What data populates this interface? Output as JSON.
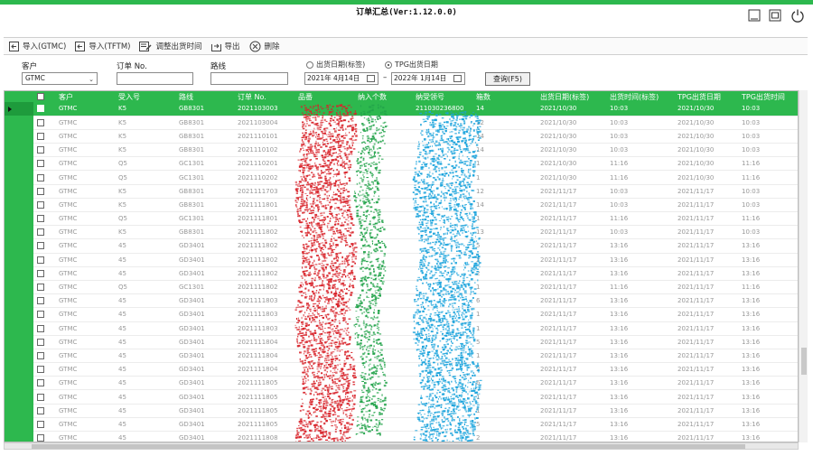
{
  "window": {
    "title": "订单汇总(Ver:1.12.0.0)"
  },
  "colors": {
    "accent": "#2db84e",
    "smear_red": "#d8232a",
    "smear_green": "#22a34a",
    "smear_blue": "#1aa3dc"
  },
  "toolbar": {
    "items": [
      {
        "label": "导入(GTMC)",
        "icon": "import-icon"
      },
      {
        "label": "导入(TFTM)",
        "icon": "import-icon"
      },
      {
        "label": "调整出货时间",
        "icon": "edit-time-icon"
      },
      {
        "label": "导出",
        "icon": "export-icon"
      },
      {
        "label": "删除",
        "icon": "delete-icon"
      }
    ]
  },
  "filter": {
    "customer_label": "客户",
    "customer_value": "GTMC",
    "order_label": "订单 No.",
    "route_label": "路线",
    "radio_ship_label": "出货日期(标签)",
    "radio_tpg_label": "TPG出货日期",
    "date_from": "2021年 4月14日",
    "date_sep": "–",
    "date_to": "2022年 1月14日",
    "query_label": "查询(F5)"
  },
  "table": {
    "headers": [
      "",
      "客户",
      "受入号",
      "路线",
      "订单 No.",
      "品番",
      "纳入个数",
      "纳受领号",
      "箱数",
      "出货日期(标签)",
      "出货时间(标签)",
      "TPG出货日期",
      "TPG出货时间"
    ],
    "rows": [
      [
        "GTMC",
        "K5",
        "GB8301",
        "2021103003",
        "",
        "",
        "211030236800",
        "14",
        "2021/10/30",
        "10:03",
        "2021/10/30",
        "10:03"
      ],
      [
        "GTMC",
        "K5",
        "GB8301",
        "2021103004",
        "",
        "",
        "",
        "12",
        "2021/10/30",
        "10:03",
        "2021/10/30",
        "10:03"
      ],
      [
        "GTMC",
        "K5",
        "GB8301",
        "2021110101",
        "",
        "",
        "",
        "14",
        "2021/10/30",
        "10:03",
        "2021/10/30",
        "10:03"
      ],
      [
        "GTMC",
        "K5",
        "GB8301",
        "2021110102",
        "",
        "",
        "",
        "14",
        "2021/10/30",
        "10:03",
        "2021/10/30",
        "10:03"
      ],
      [
        "GTMC",
        "Q5",
        "GC1301",
        "2021110201",
        "",
        "",
        "",
        "1",
        "2021/10/30",
        "11:16",
        "2021/10/30",
        "11:16"
      ],
      [
        "GTMC",
        "Q5",
        "GC1301",
        "2021110202",
        "",
        "",
        "",
        "1",
        "2021/10/30",
        "11:16",
        "2021/10/30",
        "11:16"
      ],
      [
        "GTMC",
        "K5",
        "GB8301",
        "2021111703",
        "",
        "",
        "",
        "12",
        "2021/11/17",
        "10:03",
        "2021/11/17",
        "10:03"
      ],
      [
        "GTMC",
        "K5",
        "GB8301",
        "2021111801",
        "",
        "",
        "",
        "14",
        "2021/11/17",
        "10:03",
        "2021/11/17",
        "10:03"
      ],
      [
        "GTMC",
        "Q5",
        "GC1301",
        "2021111801",
        "",
        "",
        "",
        "1",
        "2021/11/17",
        "11:16",
        "2021/11/17",
        "11:16"
      ],
      [
        "GTMC",
        "K5",
        "GB8301",
        "2021111802",
        "",
        "",
        "",
        "13",
        "2021/11/17",
        "10:03",
        "2021/11/17",
        "10:03"
      ],
      [
        "GTMC",
        "45",
        "GD3401",
        "2021111802",
        "",
        "",
        "",
        "5",
        "2021/11/17",
        "13:16",
        "2021/11/17",
        "13:16"
      ],
      [
        "GTMC",
        "45",
        "GD3401",
        "2021111802",
        "",
        "",
        "",
        "2",
        "2021/11/17",
        "13:16",
        "2021/11/17",
        "13:16"
      ],
      [
        "GTMC",
        "45",
        "GD3401",
        "2021111802",
        "",
        "",
        "",
        "2",
        "2021/11/17",
        "13:16",
        "2021/11/17",
        "13:16"
      ],
      [
        "GTMC",
        "Q5",
        "GC1301",
        "2021111802",
        "",
        "",
        "",
        "1",
        "2021/11/17",
        "11:16",
        "2021/11/17",
        "11:16"
      ],
      [
        "GTMC",
        "45",
        "GD3401",
        "2021111803",
        "",
        "",
        "",
        "6",
        "2021/11/17",
        "13:16",
        "2021/11/17",
        "13:16"
      ],
      [
        "GTMC",
        "45",
        "GD3401",
        "2021111803",
        "",
        "",
        "",
        "1",
        "2021/11/17",
        "13:16",
        "2021/11/17",
        "13:16"
      ],
      [
        "GTMC",
        "45",
        "GD3401",
        "2021111803",
        "",
        "",
        "",
        "1",
        "2021/11/17",
        "13:16",
        "2021/11/17",
        "13:16"
      ],
      [
        "GTMC",
        "45",
        "GD3401",
        "2021111804",
        "",
        "",
        "",
        "5",
        "2021/11/17",
        "13:16",
        "2021/11/17",
        "13:16"
      ],
      [
        "GTMC",
        "45",
        "GD3401",
        "2021111804",
        "",
        "",
        "",
        "1",
        "2021/11/17",
        "13:16",
        "2021/11/17",
        "13:16"
      ],
      [
        "GTMC",
        "45",
        "GD3401",
        "2021111804",
        "",
        "",
        "",
        "2",
        "2021/11/17",
        "13:16",
        "2021/11/17",
        "13:16"
      ],
      [
        "GTMC",
        "45",
        "GD3401",
        "2021111805",
        "",
        "",
        "",
        "6",
        "2021/11/17",
        "13:16",
        "2021/11/17",
        "13:16"
      ],
      [
        "GTMC",
        "45",
        "GD3401",
        "2021111805",
        "",
        "",
        "",
        "1",
        "2021/11/17",
        "13:16",
        "2021/11/17",
        "13:16"
      ],
      [
        "GTMC",
        "45",
        "GD3401",
        "2021111805",
        "",
        "",
        "",
        "1",
        "2021/11/17",
        "13:16",
        "2021/11/17",
        "13:16"
      ],
      [
        "GTMC",
        "45",
        "GD3401",
        "2021111805",
        "",
        "",
        "",
        "5",
        "2021/11/17",
        "13:16",
        "2021/11/17",
        "13:16"
      ],
      [
        "GTMC",
        "45",
        "GD3401",
        "2021111808",
        "",
        "",
        "",
        "2",
        "2021/11/17",
        "13:16",
        "2021/11/17",
        "13:16"
      ]
    ]
  }
}
